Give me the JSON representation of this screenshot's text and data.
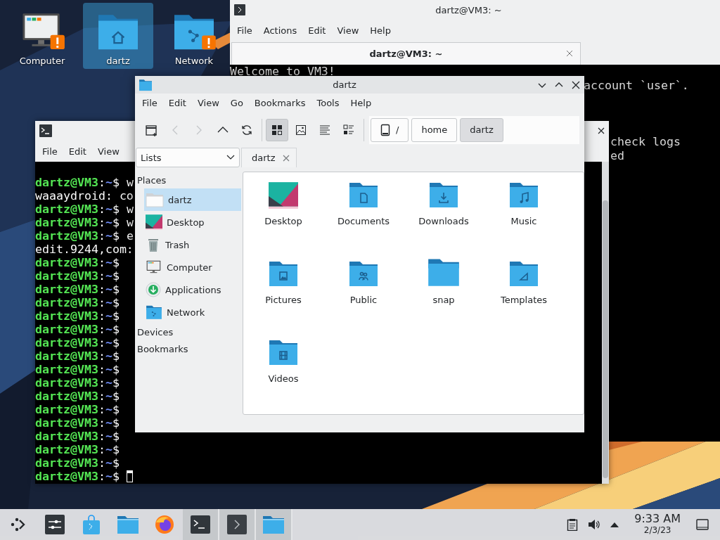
{
  "desktop_icons": [
    {
      "label": "Computer",
      "kind": "computer",
      "selected": false,
      "warning": true
    },
    {
      "label": "dartz",
      "kind": "home",
      "selected": true,
      "warning": false
    },
    {
      "label": "Network",
      "kind": "network",
      "selected": false,
      "warning": true
    }
  ],
  "back_terminal": {
    "title": "dartz@VM3: ~",
    "menu": [
      "File",
      "Actions",
      "Edit",
      "View",
      "Help"
    ],
    "tabs": [
      {
        "label": "dartz@VM3: ~",
        "selected": true
      }
    ],
    "lines_top": [
      {
        "text": "Welcome to VM3!",
        "kind": "full"
      },
      {
        "text": "account `user`.",
        "kind": "clipped"
      }
    ],
    "lines_lower": [
      {
        "text": "check logs"
      },
      {
        "text": "ed"
      }
    ]
  },
  "front_terminal": {
    "menu": [
      "File",
      "Edit",
      "View"
    ],
    "lines": [
      {
        "parts": [
          {
            "kind": "user",
            "text": "dartz@VM3"
          },
          {
            "kind": "plain",
            "text": ":"
          },
          {
            "kind": "path",
            "text": "~"
          },
          {
            "kind": "plain",
            "text": "$ w"
          }
        ],
        "cursor": false
      },
      {
        "parts": [
          {
            "kind": "plain",
            "text": "waaaydroid: co"
          }
        ],
        "cursor": false
      },
      {
        "parts": [
          {
            "kind": "user",
            "text": "dartz@VM3"
          },
          {
            "kind": "plain",
            "text": ":"
          },
          {
            "kind": "path",
            "text": "~"
          },
          {
            "kind": "plain",
            "text": "$ w"
          }
        ],
        "cursor": false
      },
      {
        "parts": [
          {
            "kind": "user",
            "text": "dartz@VM3"
          },
          {
            "kind": "plain",
            "text": ":"
          },
          {
            "kind": "path",
            "text": "~"
          },
          {
            "kind": "plain",
            "text": "$ w"
          }
        ],
        "cursor": false
      },
      {
        "parts": [
          {
            "kind": "user",
            "text": "dartz@VM3"
          },
          {
            "kind": "plain",
            "text": ":"
          },
          {
            "kind": "path",
            "text": "~"
          },
          {
            "kind": "plain",
            "text": "$ e"
          }
        ],
        "cursor": false
      },
      {
        "parts": [
          {
            "kind": "plain",
            "text": "edit.9244,com:"
          }
        ],
        "cursor": false
      },
      {
        "parts": [
          {
            "kind": "user",
            "text": "dartz@VM3"
          },
          {
            "kind": "plain",
            "text": ":"
          },
          {
            "kind": "path",
            "text": "~"
          },
          {
            "kind": "plain",
            "text": "$"
          }
        ],
        "cursor": false
      },
      {
        "parts": [
          {
            "kind": "user",
            "text": "dartz@VM3"
          },
          {
            "kind": "plain",
            "text": ":"
          },
          {
            "kind": "path",
            "text": "~"
          },
          {
            "kind": "plain",
            "text": "$"
          }
        ],
        "cursor": false
      },
      {
        "parts": [
          {
            "kind": "user",
            "text": "dartz@VM3"
          },
          {
            "kind": "plain",
            "text": ":"
          },
          {
            "kind": "path",
            "text": "~"
          },
          {
            "kind": "plain",
            "text": "$"
          }
        ],
        "cursor": false
      },
      {
        "parts": [
          {
            "kind": "user",
            "text": "dartz@VM3"
          },
          {
            "kind": "plain",
            "text": ":"
          },
          {
            "kind": "path",
            "text": "~"
          },
          {
            "kind": "plain",
            "text": "$"
          }
        ],
        "cursor": false
      },
      {
        "parts": [
          {
            "kind": "user",
            "text": "dartz@VM3"
          },
          {
            "kind": "plain",
            "text": ":"
          },
          {
            "kind": "path",
            "text": "~"
          },
          {
            "kind": "plain",
            "text": "$"
          }
        ],
        "cursor": false
      },
      {
        "parts": [
          {
            "kind": "user",
            "text": "dartz@VM3"
          },
          {
            "kind": "plain",
            "text": ":"
          },
          {
            "kind": "path",
            "text": "~"
          },
          {
            "kind": "plain",
            "text": "$"
          }
        ],
        "cursor": false
      },
      {
        "parts": [
          {
            "kind": "user",
            "text": "dartz@VM3"
          },
          {
            "kind": "plain",
            "text": ":"
          },
          {
            "kind": "path",
            "text": "~"
          },
          {
            "kind": "plain",
            "text": "$"
          }
        ],
        "cursor": false
      },
      {
        "parts": [
          {
            "kind": "user",
            "text": "dartz@VM3"
          },
          {
            "kind": "plain",
            "text": ":"
          },
          {
            "kind": "path",
            "text": "~"
          },
          {
            "kind": "plain",
            "text": "$"
          }
        ],
        "cursor": false
      },
      {
        "parts": [
          {
            "kind": "user",
            "text": "dartz@VM3"
          },
          {
            "kind": "plain",
            "text": ":"
          },
          {
            "kind": "path",
            "text": "~"
          },
          {
            "kind": "plain",
            "text": "$"
          }
        ],
        "cursor": false
      },
      {
        "parts": [
          {
            "kind": "user",
            "text": "dartz@VM3"
          },
          {
            "kind": "plain",
            "text": ":"
          },
          {
            "kind": "path",
            "text": "~"
          },
          {
            "kind": "plain",
            "text": "$"
          }
        ],
        "cursor": false
      },
      {
        "parts": [
          {
            "kind": "user",
            "text": "dartz@VM3"
          },
          {
            "kind": "plain",
            "text": ":"
          },
          {
            "kind": "path",
            "text": "~"
          },
          {
            "kind": "plain",
            "text": "$"
          }
        ],
        "cursor": false
      },
      {
        "parts": [
          {
            "kind": "user",
            "text": "dartz@VM3"
          },
          {
            "kind": "plain",
            "text": ":"
          },
          {
            "kind": "path",
            "text": "~"
          },
          {
            "kind": "plain",
            "text": "$"
          }
        ],
        "cursor": false
      },
      {
        "parts": [
          {
            "kind": "user",
            "text": "dartz@VM3"
          },
          {
            "kind": "plain",
            "text": ":"
          },
          {
            "kind": "path",
            "text": "~"
          },
          {
            "kind": "plain",
            "text": "$"
          }
        ],
        "cursor": false
      },
      {
        "parts": [
          {
            "kind": "user",
            "text": "dartz@VM3"
          },
          {
            "kind": "plain",
            "text": ":"
          },
          {
            "kind": "path",
            "text": "~"
          },
          {
            "kind": "plain",
            "text": "$"
          }
        ],
        "cursor": false
      },
      {
        "parts": [
          {
            "kind": "user",
            "text": "dartz@VM3"
          },
          {
            "kind": "plain",
            "text": ":"
          },
          {
            "kind": "path",
            "text": "~"
          },
          {
            "kind": "plain",
            "text": "$"
          }
        ],
        "cursor": false
      },
      {
        "parts": [
          {
            "kind": "user",
            "text": "dartz@VM3"
          },
          {
            "kind": "plain",
            "text": ":"
          },
          {
            "kind": "path",
            "text": "~"
          },
          {
            "kind": "plain",
            "text": "$"
          }
        ],
        "cursor": false
      },
      {
        "parts": [
          {
            "kind": "user",
            "text": "dartz@VM3"
          },
          {
            "kind": "plain",
            "text": ":"
          },
          {
            "kind": "path",
            "text": "~"
          },
          {
            "kind": "plain",
            "text": "$"
          }
        ],
        "cursor": true
      }
    ]
  },
  "file_manager": {
    "title": "dartz",
    "menu": [
      "File",
      "Edit",
      "View",
      "Go",
      "Bookmarks",
      "Tools",
      "Help"
    ],
    "navigation": [
      {
        "kind": "new-tab",
        "disabled": false
      },
      {
        "kind": "back",
        "disabled": true
      },
      {
        "kind": "forward",
        "disabled": true
      },
      {
        "kind": "up",
        "disabled": false
      },
      {
        "kind": "reload",
        "disabled": false
      }
    ],
    "view_modes": [
      {
        "kind": "icons",
        "selected": true
      },
      {
        "kind": "preview",
        "selected": false
      },
      {
        "kind": "details",
        "selected": false
      },
      {
        "kind": "compact",
        "selected": false
      }
    ],
    "breadcrumb": [
      {
        "label": "/",
        "kind": "root",
        "selected": false
      },
      {
        "label": "home",
        "kind": "folder",
        "selected": false
      },
      {
        "label": "dartz",
        "kind": "folder",
        "selected": true
      }
    ],
    "panel_selector": "Lists",
    "tabs": [
      {
        "label": "dartz",
        "selected": true
      }
    ],
    "places_heading": "Places",
    "places": [
      {
        "label": "dartz",
        "kind": "home",
        "selected": true
      },
      {
        "label": "Desktop",
        "kind": "desktop",
        "selected": false
      },
      {
        "label": "Trash",
        "kind": "trash",
        "selected": false
      },
      {
        "label": "Computer",
        "kind": "computer",
        "selected": false
      },
      {
        "label": "Applications",
        "kind": "applications",
        "selected": false
      },
      {
        "label": "Network",
        "kind": "network",
        "selected": false
      }
    ],
    "sections": [
      "Devices",
      "Bookmarks"
    ],
    "files": [
      {
        "name": "Desktop",
        "kind": "desktop"
      },
      {
        "name": "Documents",
        "kind": "documents"
      },
      {
        "name": "Downloads",
        "kind": "downloads"
      },
      {
        "name": "Music",
        "kind": "music"
      },
      {
        "name": "Pictures",
        "kind": "pictures"
      },
      {
        "name": "Public",
        "kind": "public"
      },
      {
        "name": "snap",
        "kind": "plain"
      },
      {
        "name": "Templates",
        "kind": "templates"
      },
      {
        "name": "Videos",
        "kind": "videos"
      }
    ]
  },
  "taskbar": {
    "tasks": [
      {
        "kind": "launcher",
        "open": false
      },
      {
        "kind": "settings",
        "open": false
      },
      {
        "kind": "store",
        "open": false
      },
      {
        "kind": "folder",
        "open": false
      },
      {
        "kind": "browser",
        "open": false
      },
      {
        "kind": "terminal",
        "open": true
      },
      {
        "kind": "console",
        "open": true
      },
      {
        "kind": "folder",
        "open": true
      }
    ],
    "time": "9:33 AM",
    "date": "2/3/23"
  }
}
